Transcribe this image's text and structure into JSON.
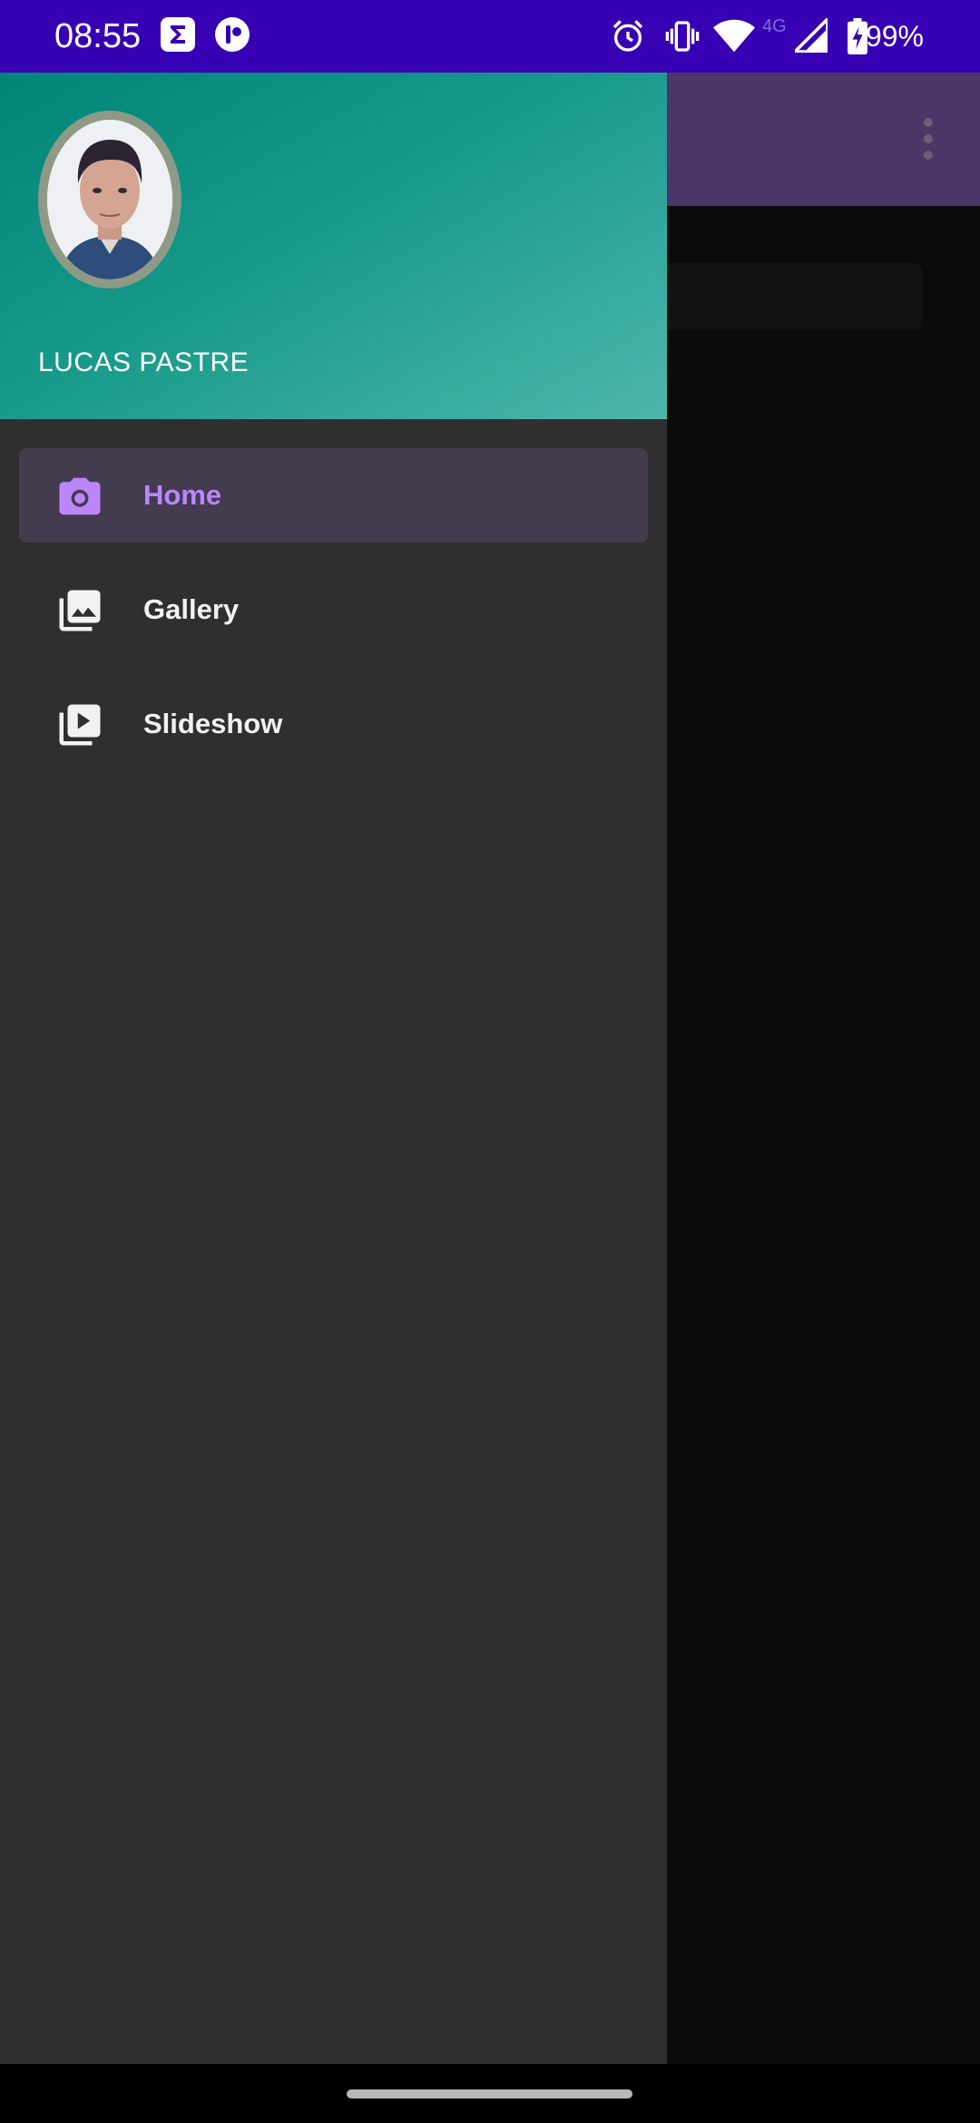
{
  "status_bar": {
    "time": "08:55",
    "battery": "99%",
    "network": "4G",
    "background_color": "#3700b3",
    "icons": [
      "sigma-app-icon",
      "circle-app-icon",
      "alarm-icon",
      "vibrate-icon",
      "wifi-icon",
      "signal-icon",
      "battery-charging-icon"
    ]
  },
  "app": {
    "toolbar_color": "#4c3567",
    "overflow_icon": "more-vert-icon"
  },
  "drawer": {
    "header": {
      "user_name": "LUCAS PASTRE",
      "avatar_icon": "profile-photo"
    },
    "items": [
      {
        "label": "Home",
        "icon": "camera-icon",
        "selected": true
      },
      {
        "label": "Gallery",
        "icon": "photo-library-icon",
        "selected": false
      },
      {
        "label": "Slideshow",
        "icon": "slideshow-icon",
        "selected": false
      }
    ],
    "accent_color": "#bb86fc",
    "background_color": "#2f2f2f"
  }
}
